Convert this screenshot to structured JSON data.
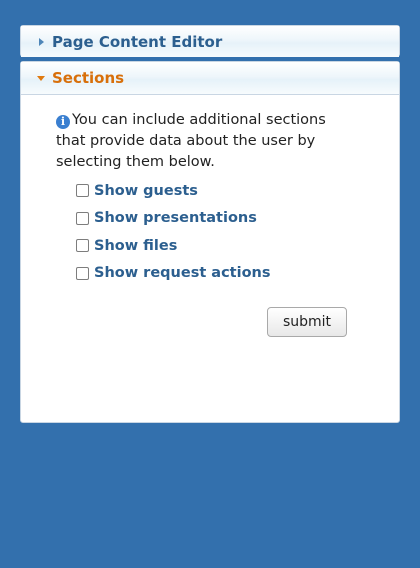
{
  "editor_panel": {
    "title": "Page Content Editor",
    "collapsed": true
  },
  "sections_panel": {
    "title": "Sections",
    "expanded": true,
    "info_text": "You can include additional sections that provide data about the user by selecting them below.",
    "options": [
      {
        "label": "Show guests",
        "checked": false
      },
      {
        "label": "Show presentations",
        "checked": false
      },
      {
        "label": "Show files",
        "checked": false
      },
      {
        "label": "Show request actions",
        "checked": false
      }
    ],
    "submit_label": "submit"
  },
  "colors": {
    "background": "#3370ad",
    "title_blue": "#2c5f8f",
    "title_orange": "#d86f0a",
    "info_icon": "#3a7fd0"
  },
  "icons": {
    "collapsed": "triangle-right-icon",
    "expanded": "triangle-down-icon",
    "info": "info-icon"
  }
}
